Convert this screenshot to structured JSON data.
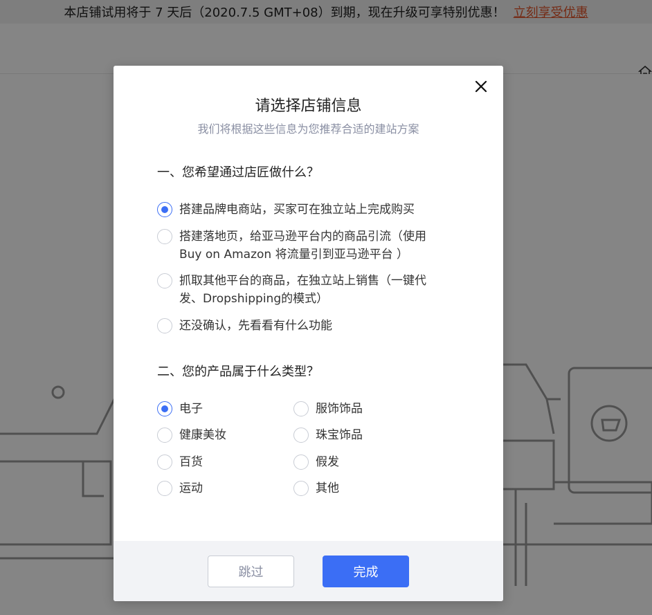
{
  "banner": {
    "text": "本店铺试用将于 7 天后（2020.7.5 GMT+08）到期，现在升级可享特别优惠！",
    "cta": "立刻享受优惠"
  },
  "modal": {
    "title": "请选择店铺信息",
    "subtitle": "我们将根据这些信息为您推荐合适的建站方案",
    "question1": {
      "title": "一、您希望通过店匠做什么？",
      "options": [
        {
          "label": "搭建品牌电商站，买家可在独立站上完成购买",
          "checked": true
        },
        {
          "label": "搭建落地页，给亚马逊平台内的商品引流（使用Buy on Amazon 将流量引到亚马逊平台 ）",
          "checked": false
        },
        {
          "label": "抓取其他平台的商品，在独立站上销售（一键代发、Dropshipping的模式）",
          "checked": false
        },
        {
          "label": "还没确认，先看看有什么功能",
          "checked": false
        }
      ]
    },
    "question2": {
      "title": "二、您的产品属于什么类型？",
      "options": [
        {
          "label": "电子",
          "checked": true
        },
        {
          "label": "服饰饰品",
          "checked": false
        },
        {
          "label": "健康美妆",
          "checked": false
        },
        {
          "label": "珠宝饰品",
          "checked": false
        },
        {
          "label": "百货",
          "checked": false
        },
        {
          "label": "假发",
          "checked": false
        },
        {
          "label": "运动",
          "checked": false
        },
        {
          "label": "其他",
          "checked": false
        }
      ]
    },
    "buttons": {
      "skip": "跳过",
      "done": "完成"
    }
  },
  "colors": {
    "accent": "#3b6ef5",
    "cta": "#e0532a"
  }
}
